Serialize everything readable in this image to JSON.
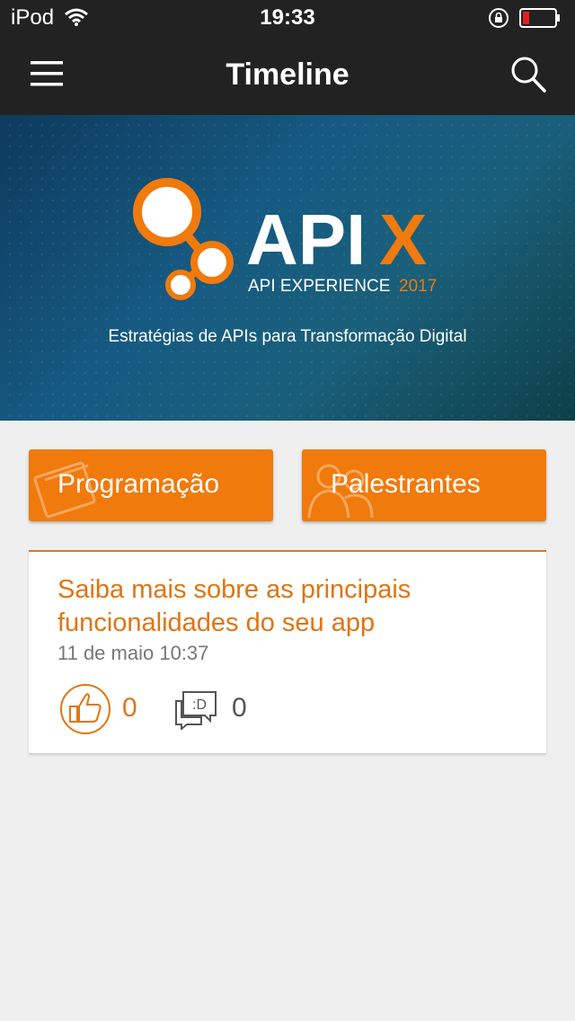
{
  "status_bar": {
    "carrier": "iPod",
    "time": "19:33",
    "icons": [
      "wifi-icon",
      "rotation-lock-icon",
      "battery-low-icon"
    ]
  },
  "nav": {
    "title": "Timeline",
    "menu_icon": "hamburger-menu-icon",
    "search_icon": "search-icon"
  },
  "banner": {
    "logo_text": "APIX",
    "logo_subtitle": "API EXPERIENCE 2017",
    "tagline": "Estratégias de APIs para Transformação Digital"
  },
  "shortcuts": [
    {
      "label": "Programação",
      "icon": "calendar-icon"
    },
    {
      "label": "Palestrantes",
      "icon": "people-icon"
    }
  ],
  "post": {
    "title": "Saiba mais sobre as principais funcionalidades do seu app",
    "date": "11 de maio 10:37",
    "likes": "0",
    "comments": "0"
  },
  "colors": {
    "accent": "#f07a0c",
    "header_bg": "#222222",
    "page_bg": "#efefef",
    "battery_low": "#e02020"
  }
}
